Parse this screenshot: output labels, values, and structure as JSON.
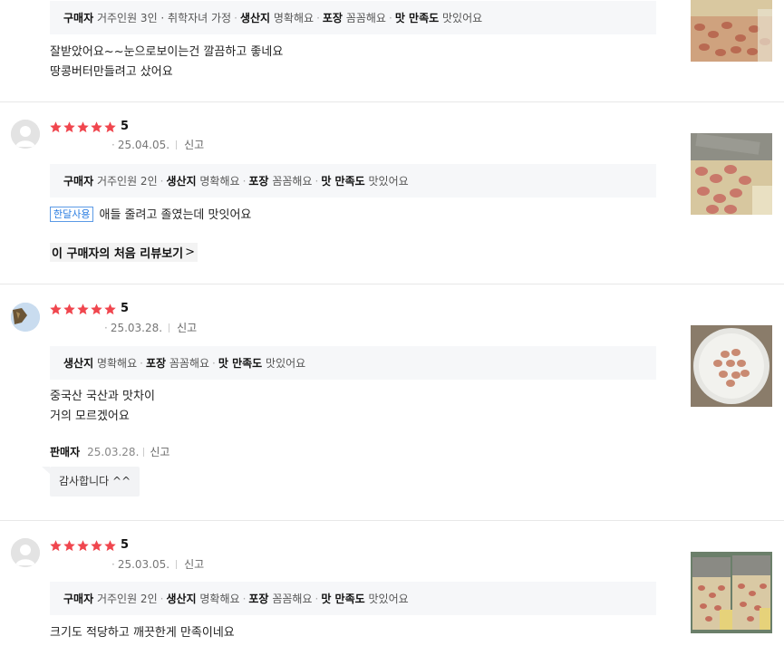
{
  "reviews": [
    {
      "tags": [
        {
          "label": "구매자",
          "value": "거주인원 3인 · 취학자녀 가정"
        },
        {
          "label": "생산지",
          "value": "명확해요"
        },
        {
          "label": "포장",
          "value": "꼼꼼해요"
        },
        {
          "label": "맛 만족도",
          "value": "맛있어요"
        }
      ],
      "text_lines": [
        "잘받았어요~~눈으로보이는건 깔끔하고 좋네요",
        "땅콩버터만들려고 샀어요"
      ]
    },
    {
      "score": "5",
      "date": "25.04.05.",
      "report": "신고",
      "tags": [
        {
          "label": "구매자",
          "value": "거주인원 2인"
        },
        {
          "label": "생산지",
          "value": "명확해요"
        },
        {
          "label": "포장",
          "value": "꼼꼼해요"
        },
        {
          "label": "맛 만족도",
          "value": "맛있어요"
        }
      ],
      "badge": "한달사용",
      "text_lines": [
        "애들 줄려고 졸였는데 맛잇어요"
      ],
      "first_review_link": "이 구매자의 처음 리뷰보기",
      "first_review_chevron": ">"
    },
    {
      "score": "5",
      "date": "25.03.28.",
      "report": "신고",
      "tags": [
        {
          "label": "생산지",
          "value": "명확해요"
        },
        {
          "label": "포장",
          "value": "꼼꼼해요"
        },
        {
          "label": "맛 만족도",
          "value": "맛있어요"
        }
      ],
      "text_lines": [
        "중국산 국산과 맛차이",
        "거의 모르겠어요"
      ],
      "seller": {
        "label": "판매자",
        "date": "25.03.28.",
        "report": "신고",
        "reply": "감사합니다 ^^"
      }
    },
    {
      "score": "5",
      "date": "25.03.05.",
      "report": "신고",
      "tags": [
        {
          "label": "구매자",
          "value": "거주인원 2인"
        },
        {
          "label": "생산지",
          "value": "명확해요"
        },
        {
          "label": "포장",
          "value": "꼼꼼해요"
        },
        {
          "label": "맛 만족도",
          "value": "맛있어요"
        }
      ],
      "text_lines": [
        "크기도 적당하고 깨끗한게 만족이네요"
      ]
    }
  ],
  "rating_stars": 5,
  "colors": {
    "star": "#f0464e",
    "badge": "#2a7de1",
    "tag_bg": "#f6f7f9"
  },
  "icons": {
    "star": "star-icon",
    "avatar": "default-avatar-icon"
  }
}
